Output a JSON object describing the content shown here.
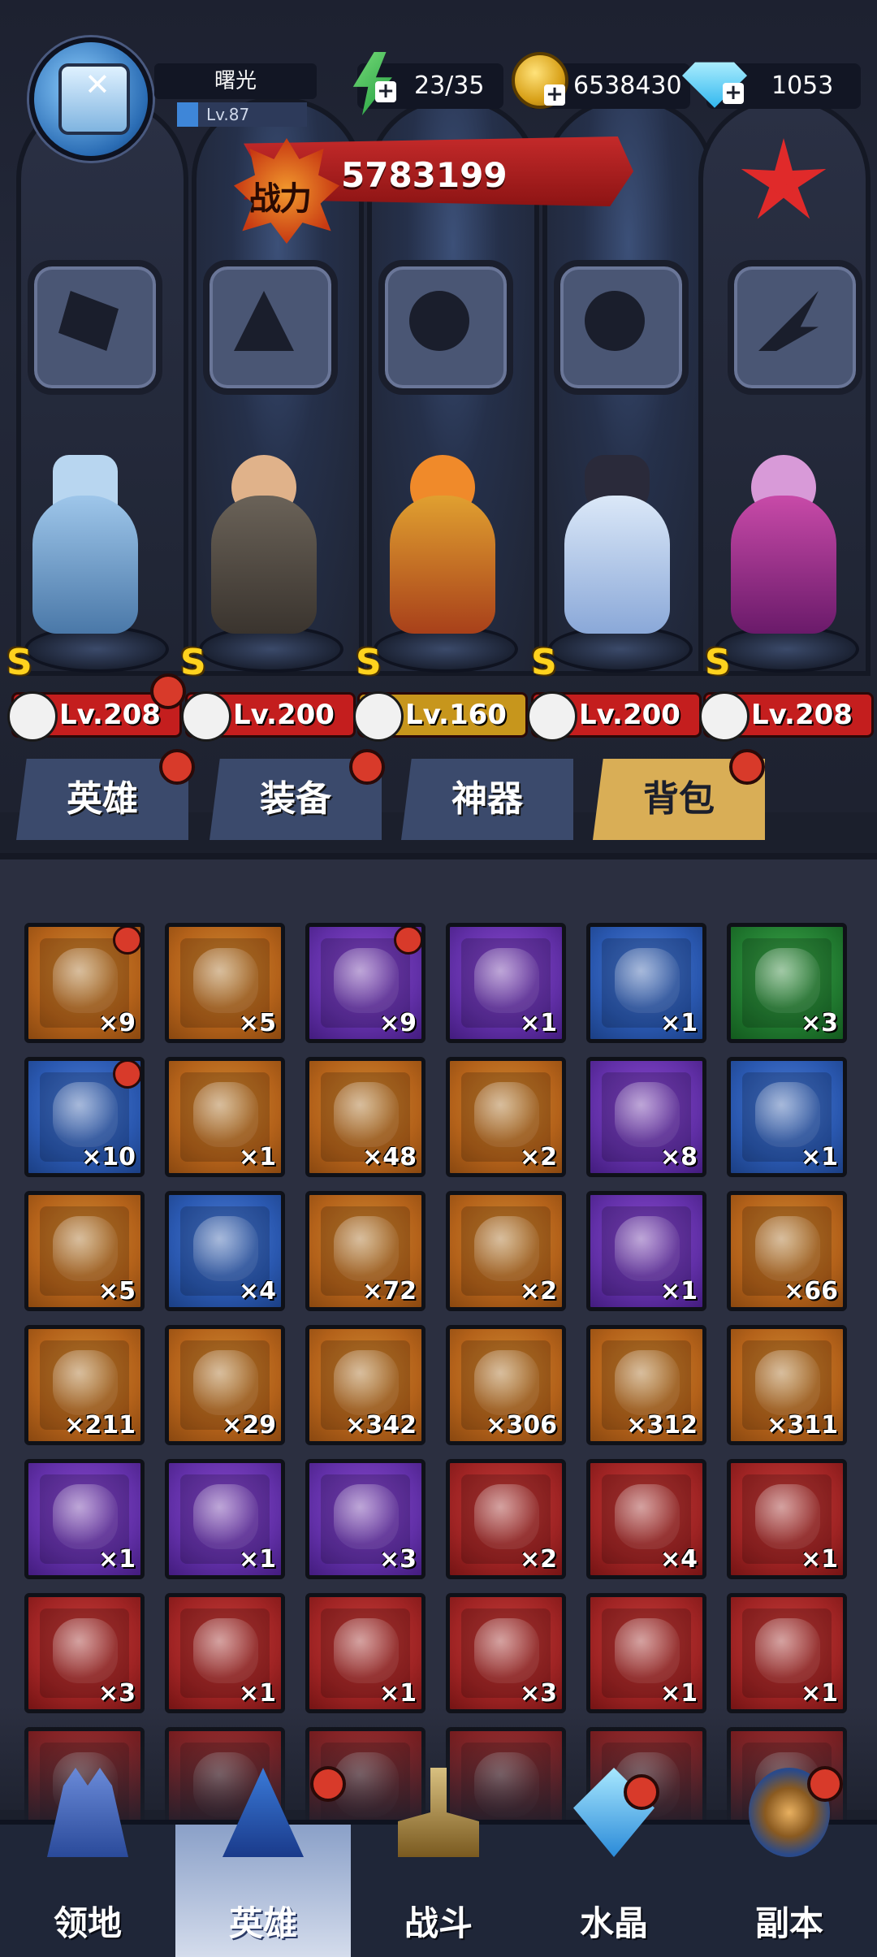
{
  "player": {
    "name": "曙光",
    "level": "Lv.87"
  },
  "resources": {
    "energy": "23/35",
    "coins": "6538430",
    "gems": "1053"
  },
  "power": {
    "label": "战力",
    "value": "5783199"
  },
  "heroes": [
    {
      "rank": "S",
      "level": "Lv.208",
      "bar": "red"
    },
    {
      "rank": "S",
      "level": "Lv.200",
      "bar": "red"
    },
    {
      "rank": "S",
      "level": "Lv.160",
      "bar": "gold"
    },
    {
      "rank": "S",
      "level": "Lv.200",
      "bar": "red"
    },
    {
      "rank": "S",
      "level": "Lv.208",
      "bar": "red"
    }
  ],
  "tabs": [
    {
      "label": "英雄",
      "active": false
    },
    {
      "label": "装备",
      "active": false
    },
    {
      "label": "神器",
      "active": false
    },
    {
      "label": "背包",
      "active": true
    }
  ],
  "inventory": [
    [
      {
        "color": "orange",
        "qty": "×9",
        "dot": true,
        "icon": "mystery-chest-icon"
      },
      {
        "color": "orange",
        "qty": "×5",
        "dot": false,
        "icon": "pointer-scroll-icon"
      },
      {
        "color": "purple",
        "qty": "×9",
        "dot": true,
        "icon": "mystery-chest-icon"
      },
      {
        "color": "purple",
        "qty": "×1",
        "dot": false,
        "icon": "book-chest-icon"
      },
      {
        "color": "blue",
        "qty": "×1",
        "dot": false,
        "icon": "book-chest-icon"
      },
      {
        "color": "green",
        "qty": "×3",
        "dot": false,
        "icon": "book-chest-icon"
      }
    ],
    [
      {
        "color": "blue",
        "qty": "×10",
        "dot": true,
        "icon": "plant-box-icon"
      },
      {
        "color": "orange",
        "qty": "×1",
        "dot": false,
        "icon": "rose-envelope-icon"
      },
      {
        "color": "orange",
        "qty": "×48",
        "dot": false,
        "icon": "star-crystal-icon"
      },
      {
        "color": "orange",
        "qty": "×2",
        "dot": false,
        "icon": "dragon-icon"
      },
      {
        "color": "purple",
        "qty": "×8",
        "dot": false,
        "icon": "scroll-icon"
      },
      {
        "color": "blue",
        "qty": "×1",
        "dot": false,
        "icon": "scroll-icon"
      }
    ],
    [
      {
        "color": "orange",
        "qty": "×5",
        "dot": false,
        "icon": "yellow-leaf-icon"
      },
      {
        "color": "blue",
        "qty": "×4",
        "dot": false,
        "icon": "green-leaf-icon"
      },
      {
        "color": "orange",
        "qty": "×72",
        "dot": false,
        "icon": "prism-crystal-icon"
      },
      {
        "color": "orange",
        "qty": "×2",
        "dot": false,
        "icon": "hex-emblem-icon"
      },
      {
        "color": "purple",
        "qty": "×1",
        "dot": false,
        "icon": "heart-envelope-icon"
      },
      {
        "color": "orange",
        "qty": "×66",
        "dot": false,
        "icon": "blue-hat-icon"
      }
    ],
    [
      {
        "color": "orange",
        "qty": "×211",
        "dot": false,
        "icon": "satellite-dish-icon"
      },
      {
        "color": "orange",
        "qty": "×29",
        "dot": false,
        "icon": "gourd-icon"
      },
      {
        "color": "orange",
        "qty": "×342",
        "dot": false,
        "icon": "sprout-icon"
      },
      {
        "color": "orange",
        "qty": "×306",
        "dot": false,
        "icon": "peach-icon"
      },
      {
        "color": "orange",
        "qty": "×312",
        "dot": false,
        "icon": "golden-bell-icon"
      },
      {
        "color": "orange",
        "qty": "×311",
        "dot": false,
        "icon": "planet-orb-icon"
      }
    ],
    [
      {
        "color": "purple",
        "qty": "×1",
        "dot": false,
        "icon": "monster-badge-icon"
      },
      {
        "color": "purple",
        "qty": "×1",
        "dot": false,
        "icon": "wolf-badge-icon"
      },
      {
        "color": "purple",
        "qty": "×3",
        "dot": false,
        "icon": "wing-badge-icon"
      },
      {
        "color": "red",
        "qty": "×2",
        "dot": false,
        "icon": "crown-piece-icon"
      },
      {
        "color": "red",
        "qty": "×4",
        "dot": false,
        "icon": "fish-piece-icon"
      },
      {
        "color": "red",
        "qty": "×1",
        "dot": false,
        "icon": "blade-piece-icon"
      }
    ],
    [
      {
        "color": "red",
        "qty": "×3",
        "dot": false,
        "icon": "dagger-piece-icon"
      },
      {
        "color": "red",
        "qty": "×1",
        "dot": false,
        "icon": "staff-piece-icon"
      },
      {
        "color": "red",
        "qty": "×1",
        "dot": false,
        "icon": "cross-piece-icon"
      },
      {
        "color": "red",
        "qty": "×3",
        "dot": false,
        "icon": "hourglass-piece-icon"
      },
      {
        "color": "red",
        "qty": "×1",
        "dot": false,
        "icon": "book-piece-icon"
      },
      {
        "color": "red",
        "qty": "×1",
        "dot": false,
        "icon": "beast-piece-icon"
      }
    ],
    [
      {
        "color": "red",
        "qty": "",
        "dot": false,
        "icon": "piece-icon"
      },
      {
        "color": "red",
        "qty": "",
        "dot": false,
        "icon": "piece-icon"
      },
      {
        "color": "red",
        "qty": "",
        "dot": false,
        "icon": "piece-icon"
      },
      {
        "color": "red",
        "qty": "",
        "dot": false,
        "icon": "piece-icon"
      },
      {
        "color": "red",
        "qty": "",
        "dot": false,
        "icon": "piece-icon"
      },
      {
        "color": "red",
        "qty": "",
        "dot": false,
        "icon": "piece-icon"
      }
    ]
  ],
  "nav": [
    {
      "label": "领地",
      "active": false,
      "icon": "castle-icon",
      "dot": false
    },
    {
      "label": "英雄",
      "active": true,
      "icon": "wizard-hat-icon",
      "dot": true
    },
    {
      "label": "战斗",
      "active": false,
      "icon": "sword-altar-icon",
      "dot": false
    },
    {
      "label": "水晶",
      "active": false,
      "icon": "crystal-icon",
      "dot": true
    },
    {
      "label": "副本",
      "active": false,
      "icon": "portal-icon",
      "dot": true
    }
  ]
}
